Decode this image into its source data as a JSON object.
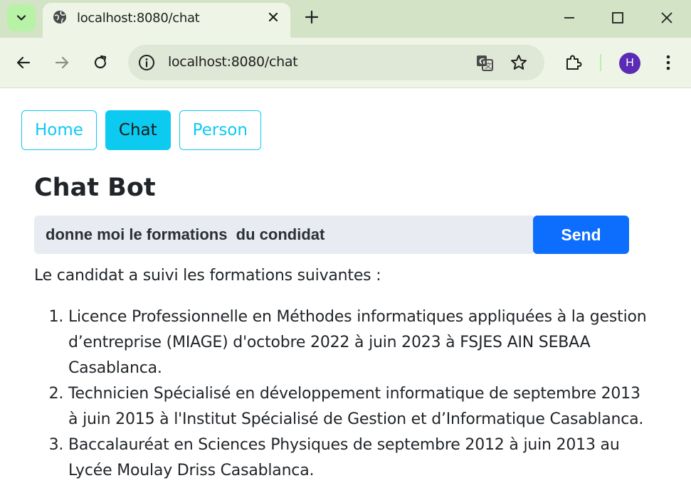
{
  "browser": {
    "tab": {
      "title": "localhost:8080/chat"
    },
    "omnibox": {
      "url": "localhost:8080/chat"
    },
    "profile": {
      "initial": "H"
    },
    "icons": [
      "chevron-down-icon",
      "globe-icon",
      "close-icon",
      "plus-icon",
      "minimize-icon",
      "maximize-icon",
      "close-window-icon",
      "back-icon",
      "forward-icon",
      "reload-icon",
      "info-icon",
      "translate-icon",
      "star-icon",
      "extensions-icon",
      "menu-icon"
    ]
  },
  "nav": {
    "items": [
      {
        "label": "Home",
        "active": false
      },
      {
        "label": "Chat",
        "active": true
      },
      {
        "label": "Person",
        "active": false
      }
    ]
  },
  "chat": {
    "title": "Chat Bot",
    "input_value": "donne moi le formations  du condidat",
    "send_label": "Send",
    "answer_intro": "Le candidat a suivi les formations suivantes :",
    "answer_items": [
      "Licence Professionnelle en Méthodes informatiques appliquées à la gestion d’entreprise (MIAGE) d'octobre 2022 à juin 2023 à FSJES AIN SEBAA Casablanca.",
      "Technicien Spécialisé en développement informatique de septembre 2013 à juin 2015 à l'Institut Spécialisé de Gestion et d’Informatique Casablanca.",
      "Baccalauréat en Sciences Physiques de septembre 2012 à juin 2013 au Lycée Moulay Driss Casablanca."
    ]
  },
  "colors": {
    "tabstrip": "#d3e3c6",
    "toolbar": "#eef5e6",
    "nav_accent": "#0dcaf0",
    "send_button": "#0d6efd",
    "input_bg": "#e8ebf1",
    "avatar": "#5b2bb5"
  }
}
